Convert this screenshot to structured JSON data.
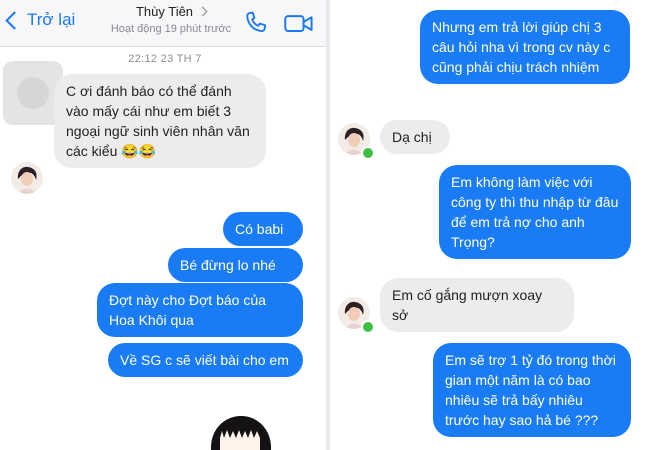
{
  "header": {
    "back_label": "Trở lại",
    "contact_name": "Thùy Tiên",
    "contact_status": "Hoạt động 19 phút trước"
  },
  "timestamp": "22:12 23 TH 7",
  "left_messages": [
    {
      "side": "received",
      "text": "C ơi đánh báo có thể đánh vào mấy cái như em biết 3 ngoại ngữ sinh viên nhân văn các kiểu 😂😂"
    },
    {
      "side": "sent",
      "text": "Có babi"
    },
    {
      "side": "sent",
      "text": "Bé đừng lo nhé"
    },
    {
      "side": "sent",
      "text": "Đợt này cho Đợt báo của Hoa Khôi qua"
    },
    {
      "side": "sent",
      "text": "Về SG c sẽ viết bài cho em"
    }
  ],
  "right_messages": [
    {
      "side": "sent",
      "text": "Nhưng em trả lời giúp chị 3 câu hỏi nha vì trong cv này c cũng phải chịu trách nhiệm"
    },
    {
      "side": "received",
      "text": "Dạ chị"
    },
    {
      "side": "sent",
      "text": "Em không làm việc với công ty thì thu nhập từ đâu để em trả nợ cho anh Trọng?"
    },
    {
      "side": "received",
      "text": "Em cố gắng mượn xoay sở"
    },
    {
      "side": "sent",
      "text": "Em sẽ trợ 1 tỷ đó trong thời gian một năm là có bao nhiêu sẽ trả bấy nhiêu trước hay sao hả bé ???"
    }
  ],
  "colors": {
    "accent": "#1a78f2",
    "sent_bubble": "#1a7cf4",
    "received_bubble": "#ececef",
    "online": "#3fbf3f"
  },
  "icons": [
    "back-chevron-icon",
    "phone-icon",
    "video-camera-icon",
    "avatar-icon",
    "online-dot-icon",
    "sticker-icon"
  ]
}
